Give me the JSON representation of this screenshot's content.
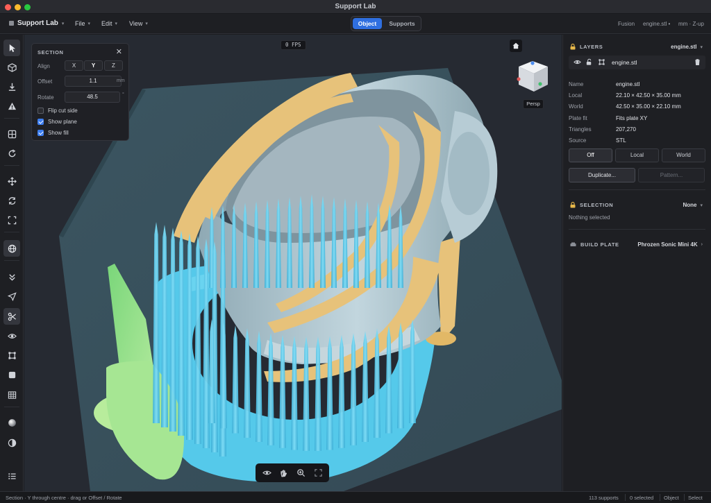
{
  "window": {
    "title": "Support Lab"
  },
  "menubar": {
    "brand": "Support Lab",
    "menus": [
      "File",
      "Edit",
      "View"
    ],
    "modes": [
      "Object",
      "Supports"
    ],
    "active_mode": "Object",
    "right": [
      "Fusion",
      "engine.stl •",
      "mm · Z-up"
    ]
  },
  "toolbar": {
    "tools": [
      "select-icon",
      "cube-icon",
      "download-icon",
      "warning-icon",
      "grid-icon",
      "rotate-circle-icon",
      "move-icon",
      "refresh-icon",
      "fit-icon",
      "globe-icon",
      "chevrons-down-icon",
      "send-icon",
      "scissors-icon",
      "eye-icon",
      "frame-icon",
      "square-icon",
      "table-icon",
      "sphere-icon",
      "contrast-icon",
      "list-icon"
    ],
    "active_tool": "scissors-icon"
  },
  "section": {
    "title": "SECTION",
    "align_label": "Align",
    "axes": [
      "X",
      "Y",
      "Z"
    ],
    "selected_axis": "Y",
    "offset_label": "Offset",
    "offset_value": "1.1",
    "offset_unit": "mm",
    "rotate_label": "Rotate",
    "rotate_value": "48.5",
    "rotate_unit": "°",
    "flip_label": "Flip cut side",
    "flip_checked": false,
    "show_plane_label": "Show plane",
    "show_plane_checked": true,
    "show_fill_label": "Show fill",
    "show_fill_checked": true
  },
  "viewport": {
    "fps": "0 FPS",
    "camera": "Persp",
    "colors": {
      "plate": "#3f5966",
      "model": "#a9c2cc",
      "support": "#52c7e8",
      "cut": "#e7c27a",
      "selected": "#8fe08a"
    }
  },
  "layers": {
    "title": "LAYERS",
    "file_select": "engine.stl",
    "layer_name": "engine.stl",
    "props": [
      {
        "k": "Name",
        "v": "engine.stl"
      },
      {
        "k": "Local",
        "v": "22.10 × 42.50 × 35.00 mm"
      },
      {
        "k": "World",
        "v": "42.50 × 35.00 × 22.10 mm"
      },
      {
        "k": "Plate fit",
        "v": "Fits plate XY"
      },
      {
        "k": "Triangles",
        "v": "207,270"
      },
      {
        "k": "Source",
        "v": "STL"
      }
    ],
    "gizmo_modes": [
      "Off",
      "Local",
      "World"
    ],
    "duplicate_label": "Duplicate...",
    "pattern_label": "Pattern..."
  },
  "selection": {
    "title": "SELECTION",
    "value": "None",
    "empty_text": "Nothing selected"
  },
  "build_plate": {
    "title": "BUILD PLATE",
    "value": "Phrozen Sonic Mini 4K"
  },
  "status": {
    "hint": "Section · Y through centre · drag or Offset / Rotate",
    "supports": "113 supports",
    "selected": "0 selected",
    "mode": "Object",
    "tool": "Select"
  }
}
